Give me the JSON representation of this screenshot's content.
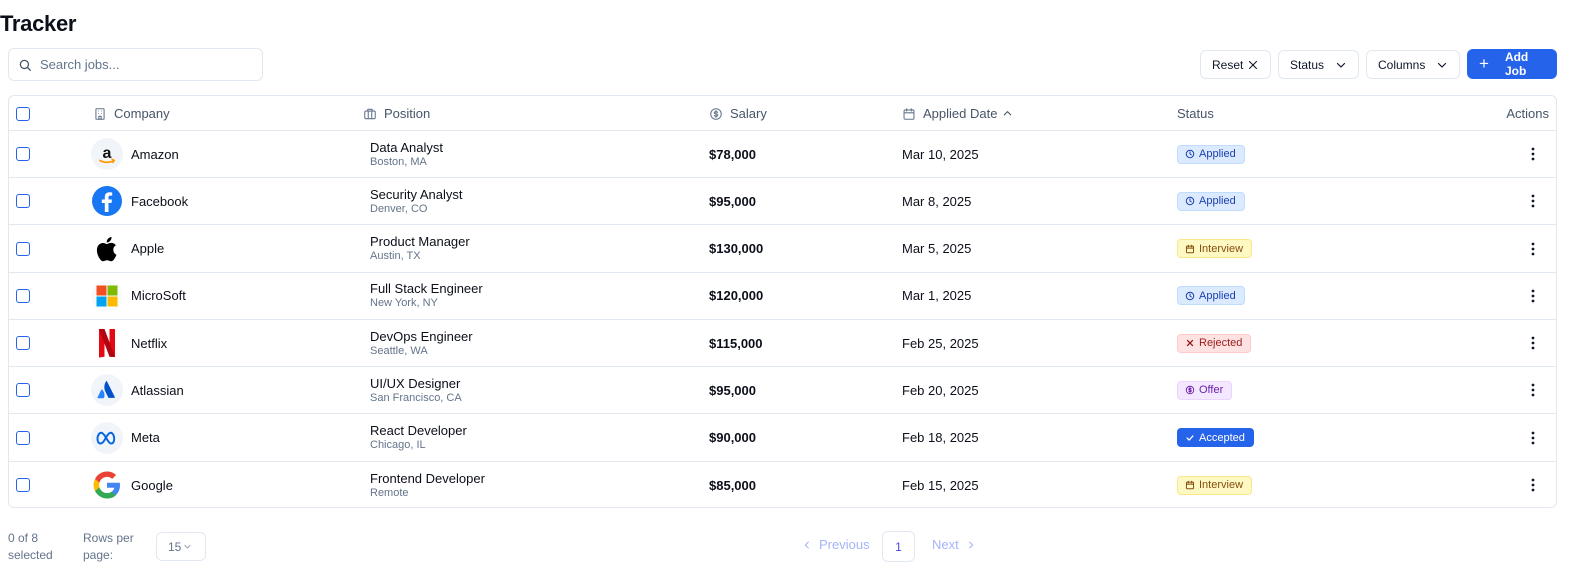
{
  "page": {
    "title": "Tracker"
  },
  "search": {
    "placeholder": "Search jobs..."
  },
  "toolbar": {
    "reset_label": "Reset",
    "status_label": "Status",
    "columns_label": "Columns",
    "add_label": "Add Job"
  },
  "columns": {
    "company": "Company",
    "position": "Position",
    "salary": "Salary",
    "applied_date": "Applied Date",
    "status": "Status",
    "actions": "Actions"
  },
  "rows": [
    {
      "company": "Amazon",
      "logo": "amazon-logo",
      "position": "Data Analyst",
      "location": "Boston, MA",
      "salary": "$78,000",
      "date": "Mar 10, 2025",
      "status": "Applied",
      "status_type": "applied"
    },
    {
      "company": "Facebook",
      "logo": "facebook-logo",
      "position": "Security Analyst",
      "location": "Denver, CO",
      "salary": "$95,000",
      "date": "Mar 8, 2025",
      "status": "Applied",
      "status_type": "applied"
    },
    {
      "company": "Apple",
      "logo": "apple-logo",
      "position": "Product Manager",
      "location": "Austin, TX",
      "salary": "$130,000",
      "date": "Mar 5, 2025",
      "status": "Interview",
      "status_type": "interview"
    },
    {
      "company": "MicroSoft",
      "logo": "microsoft-logo",
      "position": "Full Stack Engineer",
      "location": "New York, NY",
      "salary": "$120,000",
      "date": "Mar 1, 2025",
      "status": "Applied",
      "status_type": "applied"
    },
    {
      "company": "Netflix",
      "logo": "netflix-logo",
      "position": "DevOps Engineer",
      "location": "Seattle, WA",
      "salary": "$115,000",
      "date": "Feb 25, 2025",
      "status": "Rejected",
      "status_type": "rejected"
    },
    {
      "company": "Atlassian",
      "logo": "atlassian-logo",
      "position": "UI/UX Designer",
      "location": "San Francisco, CA",
      "salary": "$95,000",
      "date": "Feb 20, 2025",
      "status": "Offer",
      "status_type": "offer"
    },
    {
      "company": "Meta",
      "logo": "meta-logo",
      "position": "React Developer",
      "location": "Chicago, IL",
      "salary": "$90,000",
      "date": "Feb 18, 2025",
      "status": "Accepted",
      "status_type": "accepted"
    },
    {
      "company": "Google",
      "logo": "google-logo",
      "position": "Frontend Developer",
      "location": "Remote",
      "salary": "$85,000",
      "date": "Feb 15, 2025",
      "status": "Interview",
      "status_type": "interview"
    }
  ],
  "footer": {
    "selected_text": "0 of 8 selected",
    "rows_per_page_label": "Rows per page:",
    "rows_per_page_value": "15",
    "previous_label": "Previous",
    "next_label": "Next",
    "current_page": "1"
  },
  "colors": {
    "accent": "#2563eb",
    "applied_bg": "#dbeafe",
    "interview_bg": "#fef9c3",
    "rejected_bg": "#fee2e2",
    "offer_bg": "#f3e8ff",
    "accepted_bg": "#2563eb"
  }
}
